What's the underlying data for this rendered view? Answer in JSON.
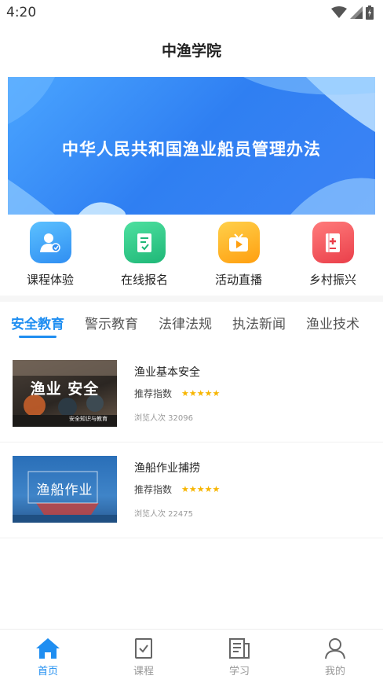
{
  "status_bar": {
    "time": "4:20"
  },
  "header": {
    "title": "中渔学院"
  },
  "banner": {
    "title": "中华人民共和国渔业船员管理办法"
  },
  "quick_actions": [
    {
      "label": "课程体验",
      "icon": "course-person-icon",
      "color": "#3aa0f5"
    },
    {
      "label": "在线报名",
      "icon": "signup-form-icon",
      "color": "#2ec486"
    },
    {
      "label": "活动直播",
      "icon": "live-tv-icon",
      "color": "#ffb11b"
    },
    {
      "label": "乡村振兴",
      "icon": "book-icon",
      "color": "#f25a5f"
    }
  ],
  "tabs": [
    {
      "label": "安全教育",
      "active": true
    },
    {
      "label": "警示教育",
      "active": false
    },
    {
      "label": "法律法规",
      "active": false
    },
    {
      "label": "执法新闻",
      "active": false
    },
    {
      "label": "渔业技术",
      "active": false
    }
  ],
  "articles": [
    {
      "title": "渔业基本安全",
      "rec_label": "推荐指数",
      "stars": "★★★★★",
      "rating": 5,
      "views": "浏览人次 32096",
      "thumb_text": "渔业 安全",
      "thumb_caption": "安全知识与教育"
    },
    {
      "title": "渔船作业捕捞",
      "rec_label": "推荐指数",
      "stars": "★★★★★",
      "rating": 5,
      "views": "浏览人次 22475",
      "thumb_text": "渔船作业"
    }
  ],
  "bottom_nav": [
    {
      "label": "首页",
      "icon": "home-icon",
      "active": true
    },
    {
      "label": "课程",
      "icon": "course-check-icon",
      "active": false
    },
    {
      "label": "学习",
      "icon": "study-book-icon",
      "active": false
    },
    {
      "label": "我的",
      "icon": "profile-icon",
      "active": false
    }
  ],
  "colors": {
    "accent": "#1f8ef1",
    "star": "#f7b500"
  }
}
